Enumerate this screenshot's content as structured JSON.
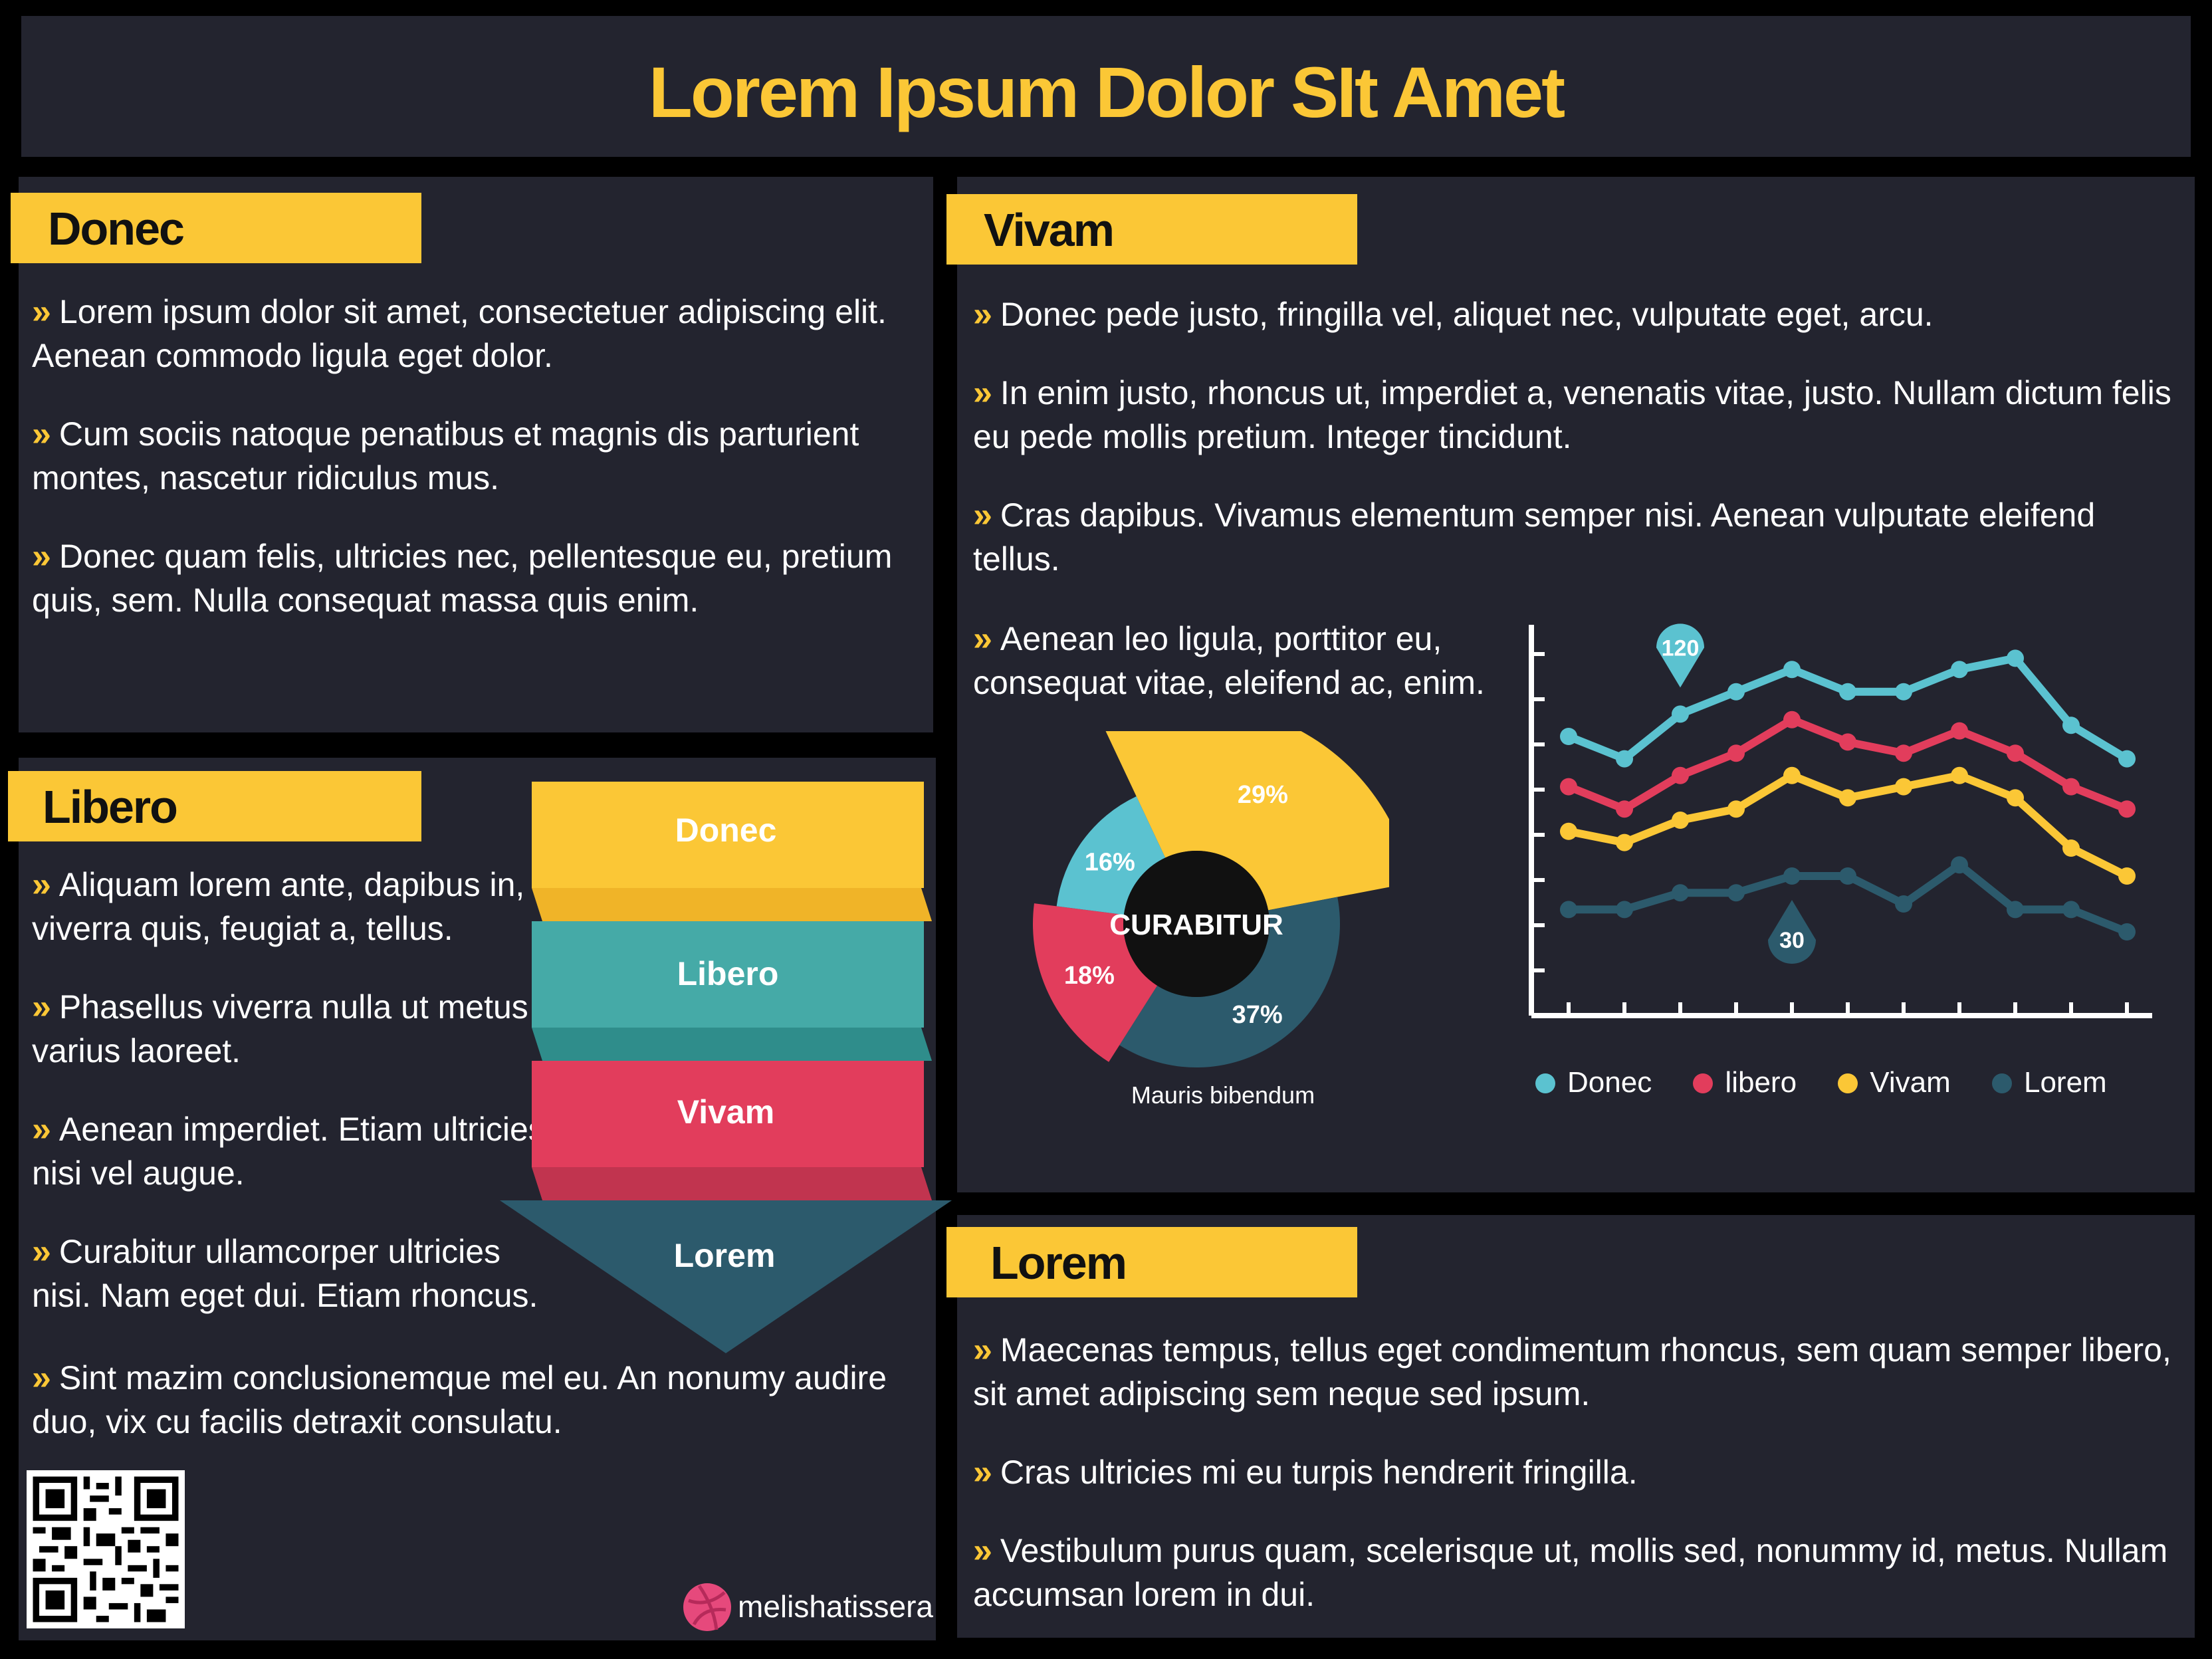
{
  "header": {
    "title": "Lorem Ipsum Dolor SIt Amet"
  },
  "donec": {
    "tag": "Donec",
    "bullets": [
      "Lorem ipsum dolor sit amet, consectetuer adipiscing elit. Aenean commodo ligula eget dolor.",
      "Cum sociis natoque penatibus et magnis dis parturient montes, nascetur ridiculus mus.",
      "Donec quam felis, ultricies nec, pellentesque eu, pretium quis, sem. Nulla consequat massa quis enim."
    ]
  },
  "libero": {
    "tag": "Libero",
    "bullets": [
      "Aliquam lorem ante, dapibus in, viverra quis, feugiat a, tellus.",
      "Phasellus viverra nulla ut metus varius laoreet.",
      "Aenean imperdiet. Etiam ultricies nisi vel augue.",
      "Curabitur ullamcorper ultricies nisi. Nam eget dui. Etiam rhoncus.",
      "Sint mazim conclusionemque mel eu. An nonumy audire duo, vix cu facilis detraxit consulatu."
    ],
    "ribbon": [
      "Donec",
      "Libero",
      "Vivam",
      "Lorem"
    ],
    "credit": "melishatissera"
  },
  "vivam": {
    "tag": "Vivam",
    "bullets": [
      "Donec pede justo, fringilla vel, aliquet nec, vulputate eget, arcu.",
      "In enim justo, rhoncus ut, imperdiet a, venenatis vitae, justo. Nullam dictum felis eu pede mollis pretium. Integer tincidunt.",
      "Cras dapibus. Vivamus elementum semper nisi. Aenean vulputate eleifend tellus.",
      "Aenean leo ligula, porttitor eu, consequat vitae, eleifend ac, enim."
    ]
  },
  "lorem": {
    "tag": "Lorem",
    "bullets": [
      "Maecenas tempus, tellus eget condimentum rhoncus, sem quam semper libero, sit amet adipiscing sem neque sed ipsum.",
      "Cras ultricies mi eu turpis hendrerit fringilla.",
      "Vestibulum purus quam, scelerisque ut, mollis sed, nonummy id, metus. Nullam accumsan lorem in dui."
    ]
  },
  "colors": {
    "yellow": "#fbc736",
    "teal": "#45aaa7",
    "red": "#e23d5c",
    "cyan": "#5bc2d0",
    "slate": "#2c5a6c",
    "panel": "#23242f"
  },
  "chart_data": [
    {
      "type": "pie",
      "center_label": "CURABITUR",
      "caption": "Mauris bibendum",
      "slices": [
        {
          "label": "29%",
          "value": 29,
          "color": "#fbc736"
        },
        {
          "label": "37%",
          "value": 37,
          "color": "#2c5a6c"
        },
        {
          "label": "18%",
          "value": 18,
          "color": "#e23d5c"
        },
        {
          "label": "16%",
          "value": 16,
          "color": "#5bc2d0"
        }
      ]
    },
    {
      "type": "line",
      "x": [
        1,
        2,
        3,
        4,
        5,
        6,
        7,
        8,
        9,
        10,
        11,
        12
      ],
      "ylim": [
        0,
        140
      ],
      "annotations": [
        {
          "text": "120",
          "series": "Donec",
          "x": 3
        },
        {
          "text": "30",
          "series": "Lorem",
          "x": 5
        }
      ],
      "series": [
        {
          "name": "Donec",
          "color": "#5bc2d0",
          "values": [
            100,
            92,
            108,
            116,
            124,
            116,
            116,
            124,
            128,
            104,
            92
          ]
        },
        {
          "name": "libero",
          "color": "#e23d5c",
          "values": [
            82,
            74,
            86,
            94,
            106,
            98,
            94,
            102,
            94,
            82,
            74
          ]
        },
        {
          "name": "Vivam",
          "color": "#fbc736",
          "values": [
            66,
            62,
            70,
            74,
            86,
            78,
            82,
            86,
            78,
            60,
            50
          ]
        },
        {
          "name": "Lorem",
          "color": "#2c5a6c",
          "values": [
            38,
            38,
            44,
            44,
            50,
            50,
            40,
            54,
            38,
            38,
            30
          ]
        }
      ]
    }
  ]
}
